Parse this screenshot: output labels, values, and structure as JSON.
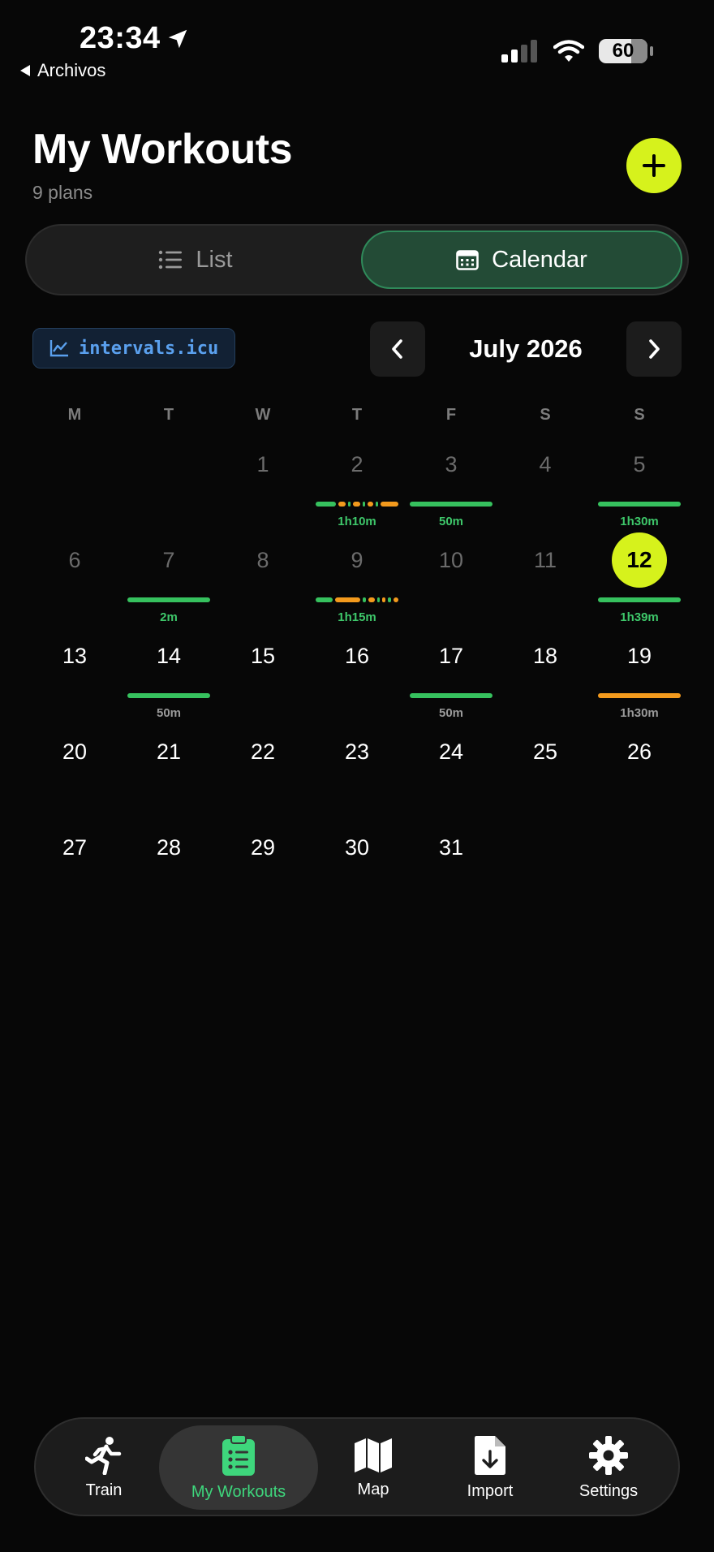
{
  "status": {
    "time": "23:34",
    "back_label": "Archivos",
    "battery": "60"
  },
  "header": {
    "title": "My Workouts",
    "subtitle": "9 plans"
  },
  "view_toggle": {
    "list_label": "List",
    "calendar_label": "Calendar",
    "selected": "Calendar"
  },
  "integration": {
    "label": "intervals.icu"
  },
  "calendar": {
    "month_label": "July 2026",
    "weekdays": [
      "M",
      "T",
      "W",
      "T",
      "F",
      "S",
      "S"
    ],
    "first_weekday_index": 2,
    "days_in_month": 31,
    "today": 12,
    "workouts": [
      {
        "day": 2,
        "duration": "1h10m",
        "label_color": "green",
        "segments": [
          [
            "#36c15e",
            3
          ],
          [
            "#f39a1d",
            1
          ],
          [
            "#36c15e",
            0.4
          ],
          [
            "#f39a1d",
            1
          ],
          [
            "#36c15e",
            0.4
          ],
          [
            "#f39a1d",
            0.8
          ],
          [
            "#36c15e",
            0.4
          ],
          [
            "#f39a1d",
            2.6
          ]
        ]
      },
      {
        "day": 3,
        "duration": "50m",
        "label_color": "green",
        "segments": [
          [
            "#36c15e",
            1
          ]
        ]
      },
      {
        "day": 5,
        "duration": "1h30m",
        "label_color": "green",
        "segments": [
          [
            "#36c15e",
            1
          ]
        ]
      },
      {
        "day": 7,
        "duration": "2m",
        "label_color": "green",
        "segments": [
          [
            "#36c15e",
            1
          ]
        ]
      },
      {
        "day": 9,
        "duration": "1h15m",
        "label_color": "green",
        "segments": [
          [
            "#36c15e",
            2.6
          ],
          [
            "#f39a1d",
            4
          ],
          [
            "#36c15e",
            0.4
          ],
          [
            "#f39a1d",
            1
          ],
          [
            "#36c15e",
            0.4
          ],
          [
            "#f39a1d",
            0.6
          ],
          [
            "#36c15e",
            0.4
          ],
          [
            "#f39a1d",
            0.8
          ]
        ]
      },
      {
        "day": 12,
        "duration": "1h39m",
        "label_color": "green",
        "segments": [
          [
            "#36c15e",
            1
          ]
        ]
      },
      {
        "day": 14,
        "duration": "50m",
        "label_color": "gray",
        "segments": [
          [
            "#36c15e",
            1
          ]
        ]
      },
      {
        "day": 17,
        "duration": "50m",
        "label_color": "gray",
        "segments": [
          [
            "#36c15e",
            1
          ]
        ]
      },
      {
        "day": 19,
        "duration": "1h30m",
        "label_color": "gray",
        "segments": [
          [
            "#f39a1d",
            1
          ]
        ]
      }
    ]
  },
  "tabs": [
    {
      "label": "Train",
      "icon": "runner-icon",
      "active": false
    },
    {
      "label": "My Workouts",
      "icon": "clipboard-icon",
      "active": true
    },
    {
      "label": "Map",
      "icon": "map-icon",
      "active": false
    },
    {
      "label": "Import",
      "icon": "import-icon",
      "active": false
    },
    {
      "label": "Settings",
      "icon": "gear-icon",
      "active": false
    }
  ],
  "colors": {
    "accent": "#d6f21c",
    "calendar_selected_bg": "#234b36",
    "workout_green": "#36c15e",
    "workout_orange": "#f39a1d",
    "link_blue": "#5aa0ee"
  }
}
